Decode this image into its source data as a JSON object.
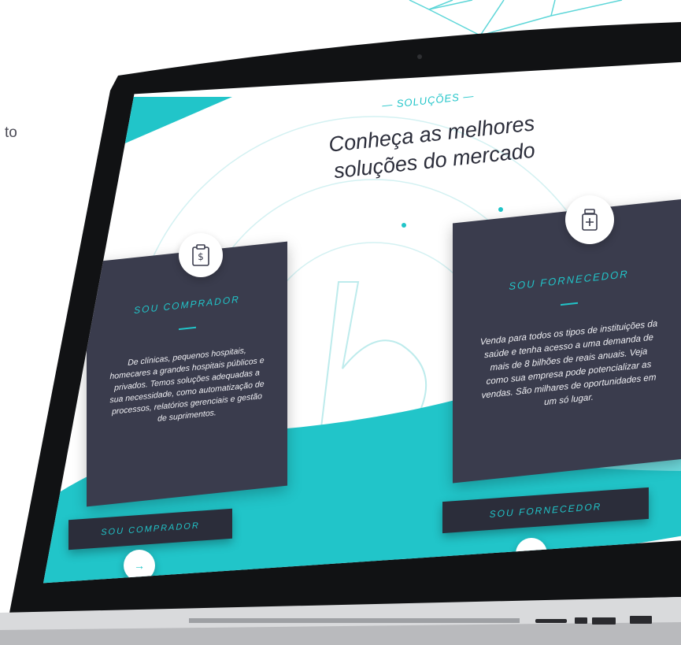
{
  "left_partial_text": "to",
  "section": {
    "eyebrow": "— SOLUÇÕES —",
    "title": "Conheça as melhores soluções do mercado"
  },
  "cards": {
    "buyer": {
      "icon": "clipboard-dollar-icon",
      "heading": "SOU COMPRADOR",
      "body": "De clínicas, pequenos hospitais, homecares a grandes hospitais públicos e privados. Temos soluções adequadas a sua necessidade, como automatização de processos, relatórios gerenciais e gestão de suprimentos.",
      "cta": "SOU COMPRADOR"
    },
    "supplier": {
      "icon": "medicine-bottle-icon",
      "heading": "SOU FORNECEDOR",
      "body": "Venda para todos os tipos de instituições da saúde e tenha acesso a uma demanda de mais de 8 bilhões de reais anuais. Veja como sua empresa pode potencializar as vendas. São milhares de oportunidades em um só lugar.",
      "cta": "SOU FORNECEDOR"
    }
  },
  "arrow_symbol": "→",
  "colors": {
    "accent": "#21c5c9",
    "card": "#3a3c4d",
    "dark": "#2b2d3a"
  }
}
